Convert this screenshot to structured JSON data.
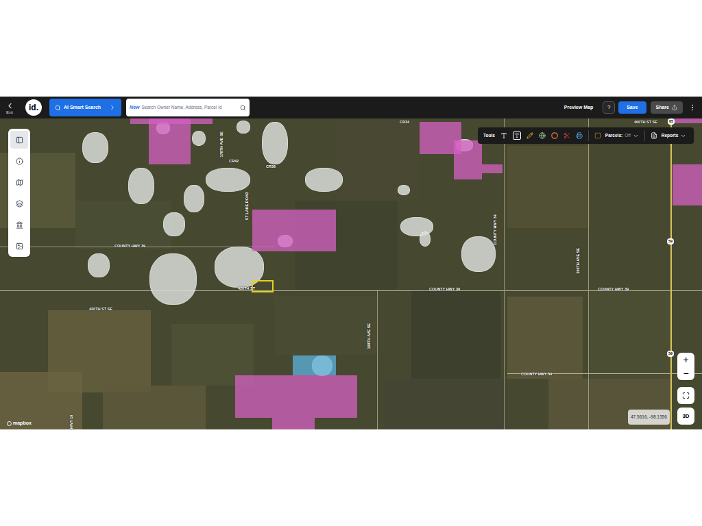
{
  "header": {
    "back_label": "Exit",
    "logo": "id.",
    "ai_button": "AI Smart Search",
    "search_badge": "New",
    "search_placeholder": "Search Owner Name, Address, Parcel Id",
    "preview": "Preview Map",
    "help": "?",
    "save": "Save",
    "share": "Share"
  },
  "toolbar": {
    "title": "Tools",
    "parcels_label": "Parcels:",
    "parcels_state": "Off",
    "reports": "Reports"
  },
  "side_tools": [
    {
      "kind": "panel",
      "selected": true
    },
    {
      "kind": "info",
      "selected": false
    },
    {
      "kind": "map",
      "selected": false
    },
    {
      "kind": "layers",
      "selected": false
    },
    {
      "kind": "buildings",
      "selected": false
    },
    {
      "kind": "image",
      "selected": false
    }
  ],
  "map": {
    "road_labels": [
      {
        "text": "CR34",
        "kind": "horizontal"
      },
      {
        "text": "CR42",
        "kind": "horizontal"
      },
      {
        "text": "CR36",
        "kind": "horizontal"
      },
      {
        "text": "COUNTY HWY 39",
        "kind": "horizontal"
      },
      {
        "text": "420TH ST",
        "kind": "horizontal"
      },
      {
        "text": "COUNTY HWY 39",
        "kind": "horizontal"
      },
      {
        "text": "COUNTY HWY 39",
        "kind": "horizontal"
      },
      {
        "text": "420TH ST SE",
        "kind": "horizontal"
      },
      {
        "text": "COUNTY HWY 34",
        "kind": "vertical"
      },
      {
        "text": "198TH AVE SE",
        "kind": "vertical"
      },
      {
        "text": "200TH AVE SE",
        "kind": "vertical"
      },
      {
        "text": "COUNTY HWY 34",
        "kind": "horizontal"
      },
      {
        "text": "400TH ST SE",
        "kind": "horizontal"
      },
      {
        "text": "176TH AVE SE",
        "kind": "vertical"
      },
      {
        "text": "ST LAKE ROAD",
        "kind": "vertical"
      },
      {
        "text": "HWY 10",
        "kind": "vertical"
      }
    ],
    "shields": [
      "65",
      "59",
      "59"
    ],
    "parcels": [
      {
        "color": "#d660c4",
        "selected": false
      },
      {
        "color": "#d660c4",
        "selected": false
      },
      {
        "color": "#d660c4",
        "selected": false
      },
      {
        "color": "#d660c4",
        "selected": false
      },
      {
        "color": "#d660c4",
        "selected": false
      },
      {
        "color": "#5cb3dd",
        "selected": false
      },
      {
        "color": "#e6d21d",
        "selected": true
      }
    ],
    "attribution": "mapbox",
    "coordinates": "47.5616, -98.1356",
    "zoom_in": "+",
    "zoom_out": "−",
    "view_button": "3D"
  }
}
